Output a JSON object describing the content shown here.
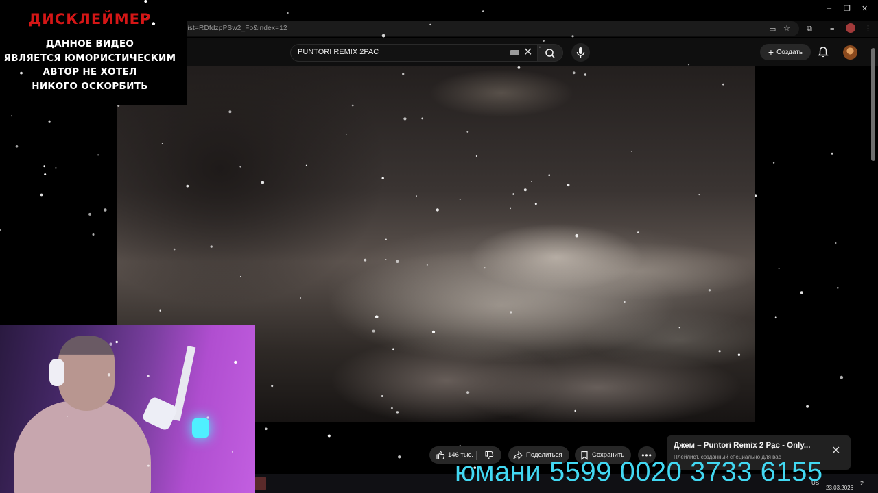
{
  "browser": {
    "url_fragment": "list=RDfdzpPSw2_Fo&index=12"
  },
  "disclaimer": {
    "title": "ДИСКЛЕЙМЕР",
    "lines": [
      "ДАННОЕ ВИДЕО",
      "ЯВЛЯЕТСЯ ЮМОРИСТИЧЕСКИМ",
      "АВТОР НЕ ХОТЕЛ",
      "НИКОГО ОСКОРБИТЬ"
    ]
  },
  "youtube": {
    "search_value": "PUNTORI REMIX 2PAC",
    "create_label": "Создать",
    "likes": "146 тыс.",
    "share_label": "Поделиться",
    "save_label": "Сохранить"
  },
  "notification": {
    "title": "Джем – Puntori Remix 2 Pac - Only...",
    "subtitle": "Плейлист, созданный специально для вас"
  },
  "overlay": {
    "donation_text": "юмани 5599 0020 3733 6155"
  },
  "taskbar": {
    "lang": "US",
    "date": "23.03.2026",
    "notifications": "2"
  },
  "colors": {
    "disclaimer_title": "#d41616",
    "donation_text": "#42d8f2",
    "yt_background": "#0f0f0f"
  }
}
